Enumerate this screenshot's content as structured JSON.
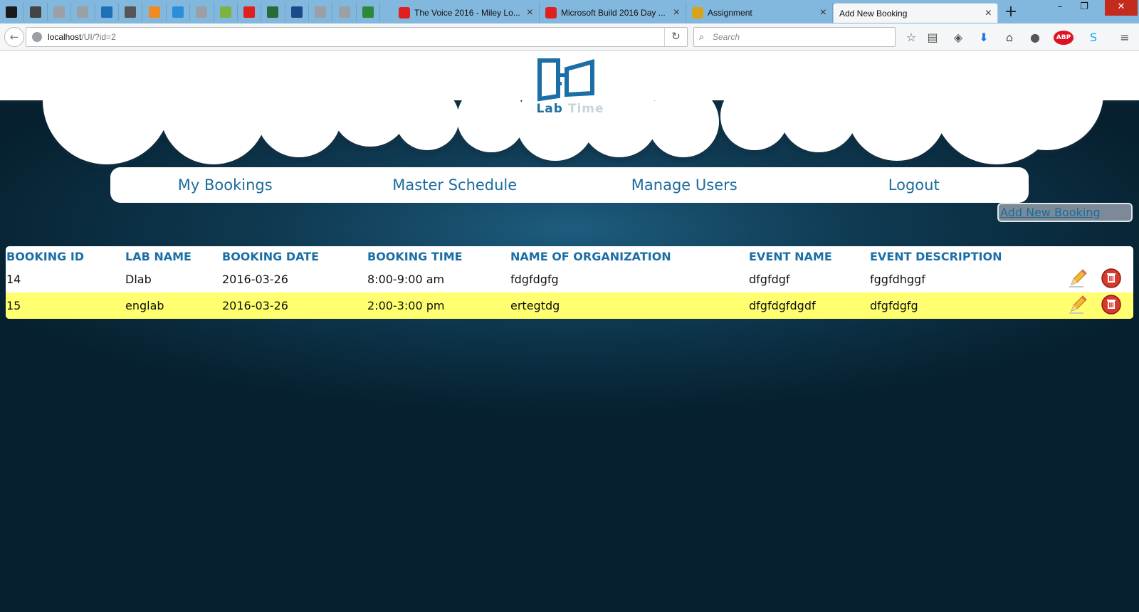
{
  "browser": {
    "pinned_tabs": [
      {
        "icon": "pulse-icon",
        "color": "#1a1a1a"
      },
      {
        "icon": "diamond-icon",
        "color": "#444"
      },
      {
        "icon": "blank-page-icon",
        "color": "#9aa0a6"
      },
      {
        "icon": "blank-page-icon",
        "color": "#9aa0a6"
      },
      {
        "icon": "swirl-icon",
        "color": "#1f6fb7"
      },
      {
        "icon": "book-icon",
        "color": "#555"
      },
      {
        "icon": "orange-circle-icon",
        "color": "#f08a24"
      },
      {
        "icon": "blue-circle-icon",
        "color": "#2a8fd8"
      },
      {
        "icon": "blank-page-icon",
        "color": "#9aa0a6"
      },
      {
        "icon": "android-icon",
        "color": "#7cb342"
      },
      {
        "icon": "youtube-icon",
        "color": "#e02020"
      },
      {
        "icon": "vs-icon",
        "color": "#2a6a3a"
      },
      {
        "icon": "ifc-icon",
        "color": "#1a4a8a"
      },
      {
        "icon": "blank-page-icon",
        "color": "#9aa0a6"
      },
      {
        "icon": "blank-page-icon",
        "color": "#9aa0a6"
      },
      {
        "icon": "letter-a-icon",
        "color": "#2a8a3a"
      }
    ],
    "tabs": [
      {
        "title": "The Voice 2016 - Miley Lo...",
        "icon": "youtube-icon",
        "color": "#e02020",
        "active": false
      },
      {
        "title": "Microsoft Build 2016 Day ...",
        "icon": "youtube-icon",
        "color": "#e02020",
        "active": false
      },
      {
        "title": "Assignment",
        "icon": "assignment-icon",
        "color": "#d9a21b",
        "active": false
      },
      {
        "title": "Add New Booking",
        "icon": "",
        "color": "",
        "active": true
      }
    ],
    "url_host": "localhost",
    "url_path": "/UI/?id=2",
    "search_placeholder": "Search"
  },
  "logo": {
    "word1": "Lab",
    "word2": "Time"
  },
  "menu": {
    "items": [
      "My Bookings",
      "Master Schedule",
      "Manage Users",
      "Logout"
    ]
  },
  "add_booking_label": "Add New Booking",
  "table": {
    "headers": [
      "BOOKING ID",
      "LAB NAME",
      "BOOKING DATE",
      "BOOKING TIME",
      "NAME OF ORGANIZATION",
      "EVENT NAME",
      "EVENT DESCRIPTION"
    ],
    "rows": [
      {
        "id": "14",
        "lab": "Dlab",
        "date": "2016-03-26",
        "time": "8:00-9:00 am",
        "org": "fdgfdgfg",
        "event": "dfgfdgf",
        "desc": "fggfdhggf",
        "highlight": false
      },
      {
        "id": "15",
        "lab": "englab",
        "date": "2016-03-26",
        "time": "2:00-3:00 pm",
        "org": "ertegtdg",
        "event": "dfgfdgfdgdf",
        "desc": "dfgfdgfg",
        "highlight": true
      }
    ]
  },
  "colors": {
    "brand_blue": "#1c6fa6",
    "highlight_row": "#ffff70",
    "page_bg": "#06202f"
  }
}
